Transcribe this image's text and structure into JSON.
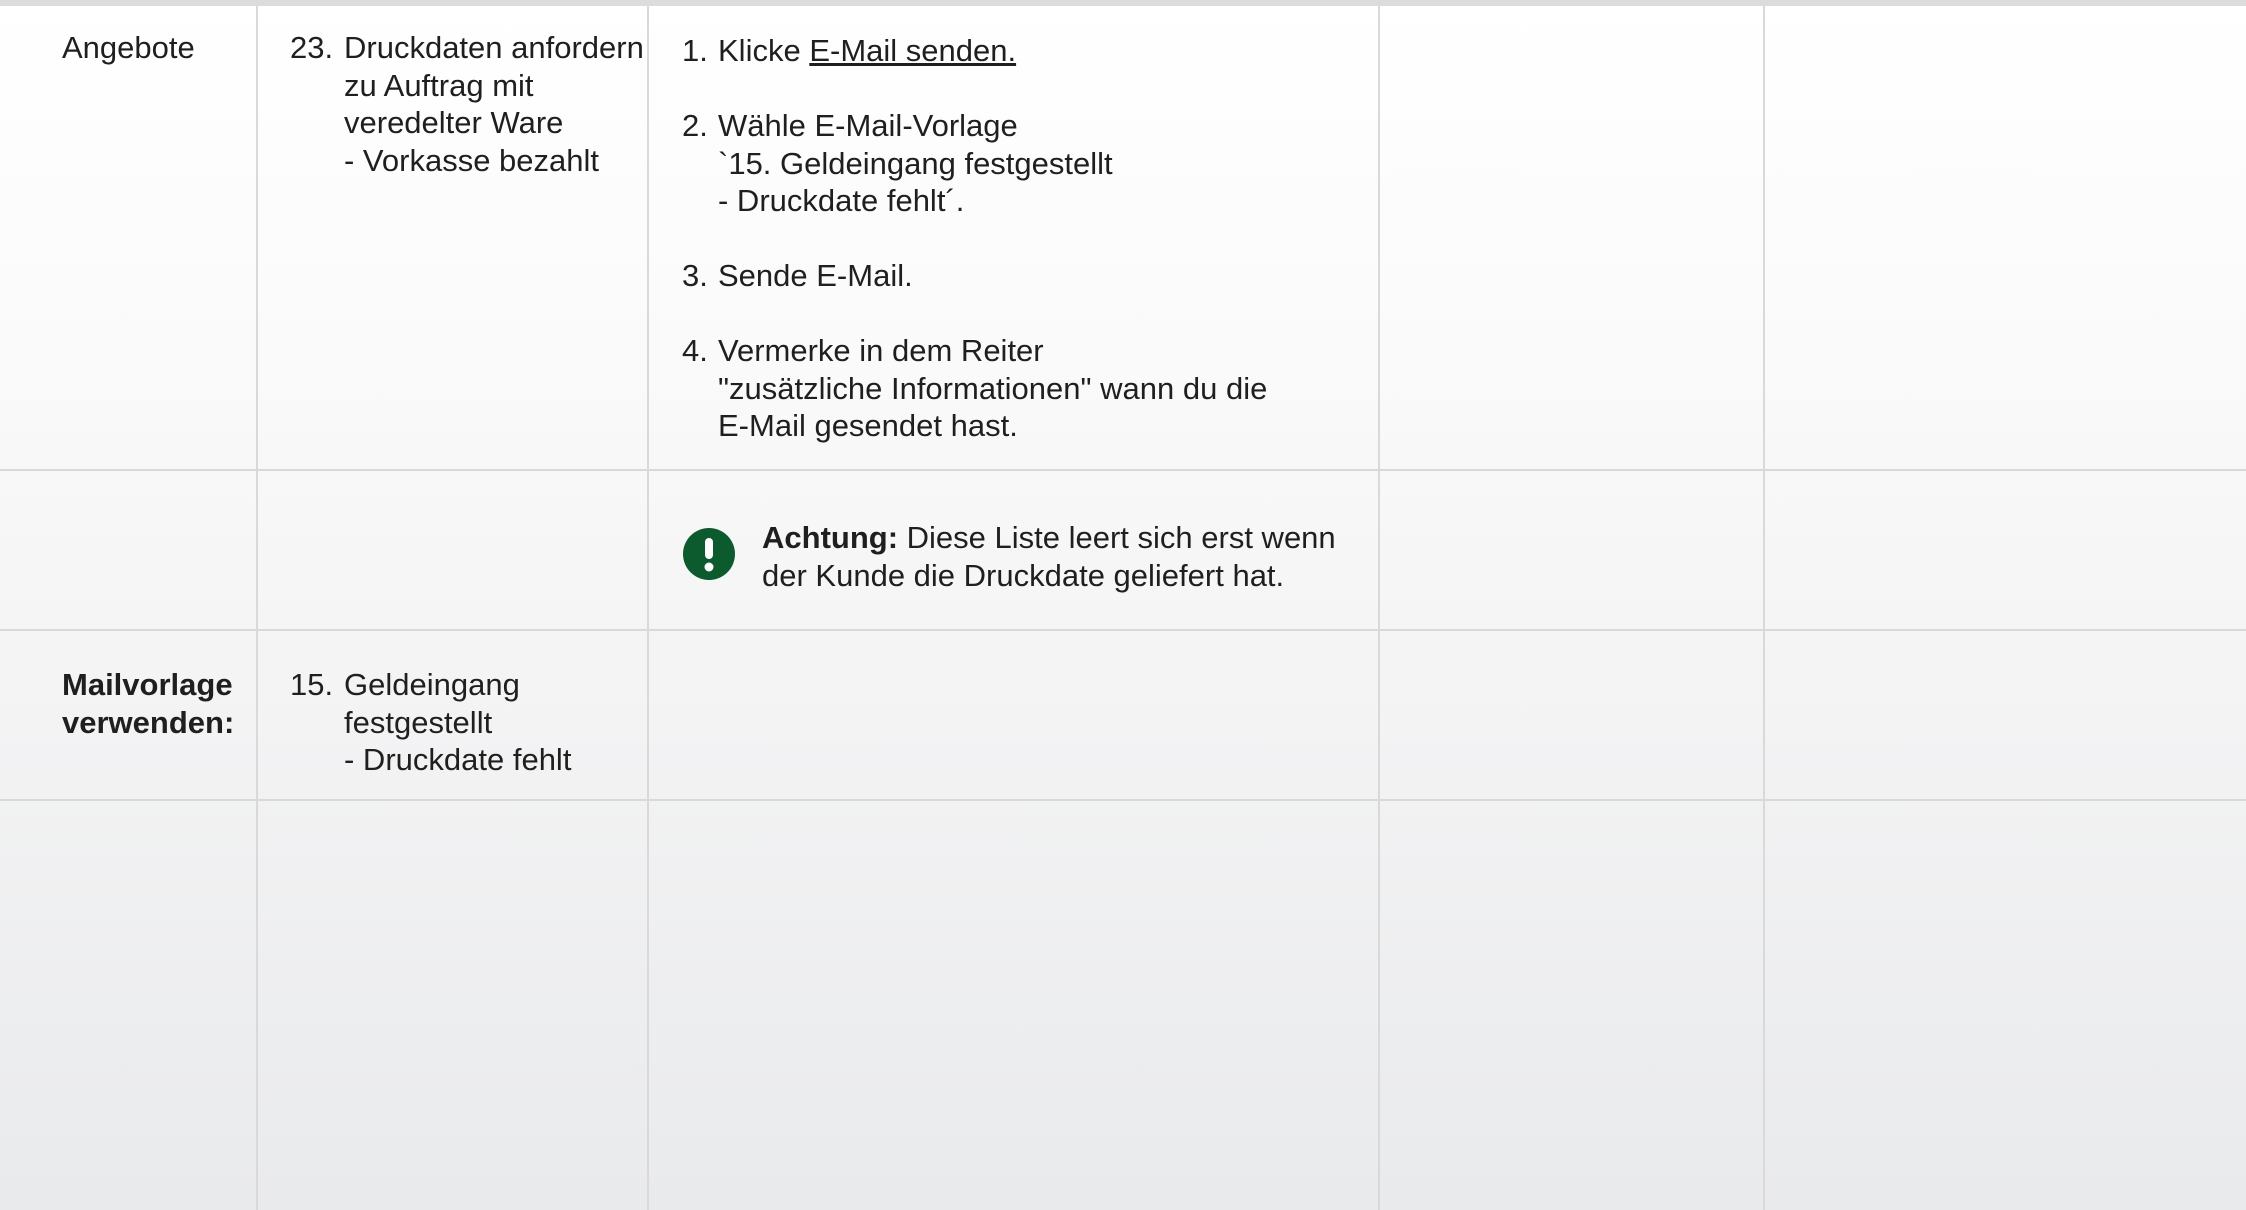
{
  "row1": {
    "label": "Angebote",
    "task_number": "23.",
    "task_lines": [
      "Druckdaten anfordern",
      "zu Auftrag mit",
      "veredelter Ware",
      "- Vorkasse bezahlt"
    ],
    "steps": [
      {
        "number": "1.",
        "prefix": "Klicke ",
        "link": "E-Mail senden."
      },
      {
        "number": "2.",
        "lines": [
          "Wähle E-Mail-Vorlage",
          "`15. Geldeingang festgestellt",
          "- Druckdate fehlt´."
        ]
      },
      {
        "number": "3.",
        "lines": [
          "Sende E-Mail."
        ]
      },
      {
        "number": "4.",
        "lines": [
          "Vermerke in dem Reiter",
          "\"zusätzliche Informationen\" wann du die",
          "E-Mail gesendet hast."
        ]
      }
    ]
  },
  "row2": {
    "warning_icon": "exclamation-circle-icon",
    "warning_color": "#0b5b2e",
    "warning_bold": "Achtung:",
    "warning_line1": " Diese Liste leert sich erst wenn",
    "warning_line2": "der Kunde die Druckdate geliefert hat."
  },
  "row3": {
    "label_line1": "Mailvorlage",
    "label_line2": "verwenden:",
    "template_number": "15.",
    "template_lines": [
      "Geldeingang",
      "festgestellt",
      "- Druckdate fehlt"
    ]
  }
}
